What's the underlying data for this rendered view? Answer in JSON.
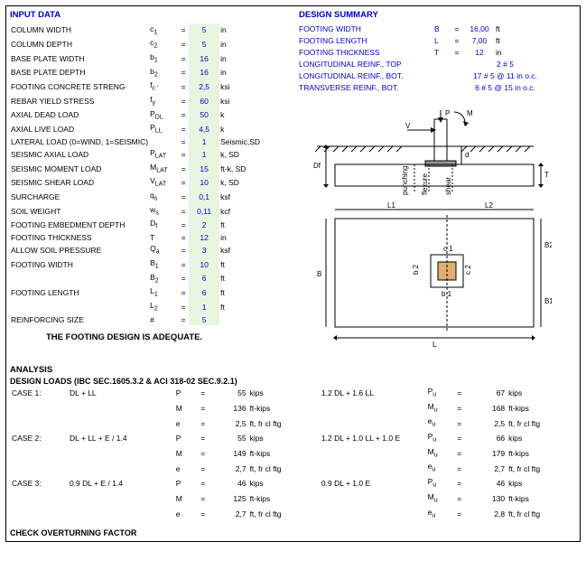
{
  "sections": {
    "input_title": "INPUT DATA",
    "summary_title": "DESIGN SUMMARY",
    "analysis_title": "ANALYSIS",
    "loads_title": "DESIGN  LOADS (IBC SEC.1605.3.2 & ACI 318-02 SEC.9.2.1)",
    "overturn_title": "CHECK OVERTURNING FACTOR"
  },
  "adequate": "THE FOOTING DESIGN IS ADEQUATE.",
  "input_rows": [
    {
      "label": "COLUMN WIDTH",
      "sym": "c",
      "sub": "1",
      "val": "5",
      "unit": "in"
    },
    {
      "label": "COLUMN DEPTH",
      "sym": "c",
      "sub": "2",
      "val": "5",
      "unit": "in"
    },
    {
      "label": "BASE PLATE WIDTH",
      "sym": "b",
      "sub": "1",
      "val": "16",
      "unit": "in"
    },
    {
      "label": "BASE PLATE DEPTH",
      "sym": "b",
      "sub": "2",
      "val": "16",
      "unit": "in"
    },
    {
      "label": "FOOTING CONCRETE STRENG·",
      "sym": "f",
      "sub": "c '",
      "val": "2,5",
      "unit": "ksi"
    },
    {
      "label": "REBAR YIELD STRESS",
      "sym": "f",
      "sub": "y",
      "val": "60",
      "unit": "ksi"
    },
    {
      "label": "AXIAL DEAD LOAD",
      "sym": "P",
      "sub": "DL",
      "val": "50",
      "unit": "k"
    },
    {
      "label": "AXIAL LIVE LOAD",
      "sym": "P",
      "sub": "LL",
      "val": "4,5",
      "unit": "k"
    },
    {
      "label": "LATERAL LOAD (0=WIND, 1=SEISMIC)",
      "sym": "",
      "sub": "",
      "val": "1",
      "unit": "Seismic,SD"
    },
    {
      "label": "SEISMIC AXIAL LOAD",
      "sym": "P",
      "sub": "LAT",
      "val": "1",
      "unit": "k, SD"
    },
    {
      "label": "SEISMIC MOMENT LOAD",
      "sym": "M",
      "sub": "LAT",
      "val": "15",
      "unit": "ft-k, SD"
    },
    {
      "label": "SEISMIC SHEAR LOAD",
      "sym": "V",
      "sub": "LAT",
      "val": "10",
      "unit": "k, SD"
    },
    {
      "label": "SURCHARGE",
      "sym": "q",
      "sub": "s",
      "val": "0,1",
      "unit": "ksf"
    },
    {
      "label": "SOIL WEIGHT",
      "sym": "w",
      "sub": "s",
      "val": "0,11",
      "unit": "kcf"
    },
    {
      "label": "FOOTING EMBEDMENT DEPTH",
      "sym": "D",
      "sub": "f",
      "val": "2",
      "unit": "ft"
    },
    {
      "label": "FOOTING THICKNESS",
      "sym": "T",
      "sub": "",
      "val": "12",
      "unit": "in"
    },
    {
      "label": "ALLOW SOIL PRESSURE",
      "sym": "Q",
      "sub": "a",
      "val": "3",
      "unit": "ksf"
    },
    {
      "label": "FOOTING WIDTH",
      "sym": "B",
      "sub": "1",
      "val": "10",
      "unit": "ft"
    },
    {
      "label": "",
      "sym": "B",
      "sub": "2",
      "val": "6",
      "unit": "ft"
    },
    {
      "label": "FOOTING LENGTH",
      "sym": "L",
      "sub": "1",
      "val": "6",
      "unit": "ft"
    },
    {
      "label": "",
      "sym": "L",
      "sub": "2",
      "val": "1",
      "unit": "ft"
    },
    {
      "label": "REINFORCING SIZE",
      "sym": "#",
      "sub": "",
      "val": "5",
      "unit": ""
    }
  ],
  "summary_rows": [
    {
      "label": "FOOTING WIDTH",
      "sym": "B",
      "val": "16,00",
      "unit": "ft"
    },
    {
      "label": "FOOTING LENGTH",
      "sym": "L",
      "val": "7,00",
      "unit": "ft"
    },
    {
      "label": "FOOTING THICKNESS",
      "sym": "T",
      "val": "12",
      "unit": "in"
    }
  ],
  "reinf": [
    {
      "label": "LONGITUDINAL REINF., TOP",
      "val": "2 # 5"
    },
    {
      "label": "LONGITUDINAL REINF., BOT.",
      "val": "17 # 5 @ 11 in o.c."
    },
    {
      "label": "TRANSVERSE REINF., BOT.",
      "val": "6 # 5 @ 15 in o.c."
    }
  ],
  "diagram_labels": {
    "P": "P",
    "M": "M",
    "V": "V",
    "Df": "Df",
    "d": "d",
    "T": "T",
    "L1": "L1",
    "L2": "L2",
    "c1": "c 1",
    "c2": "c 2",
    "b1": "b 1",
    "b2": "b 2",
    "B": "B",
    "B1": "B1",
    "B2": "B2",
    "L": "L",
    "punching": "punching",
    "flexure": "flexure",
    "shear": "shear"
  },
  "cases": [
    {
      "name": "CASE 1:",
      "combo": "DL + LL",
      "left": [
        {
          "sym": "P",
          "val": "55",
          "unit": "kips"
        },
        {
          "sym": "M",
          "val": "136",
          "unit": "ft-kips"
        },
        {
          "sym": "e",
          "val": "2,5",
          "unit": "ft, fr cl ftg"
        }
      ],
      "combo2": "1.2 DL + 1.6 LL",
      "right": [
        {
          "sym": "P",
          "sub": "u",
          "val": "67",
          "unit": "kips"
        },
        {
          "sym": "M",
          "sub": "u",
          "val": "168",
          "unit": "ft-kips"
        },
        {
          "sym": "e",
          "sub": "u",
          "val": "2,5",
          "unit": "ft, fr cl ftg"
        }
      ]
    },
    {
      "name": "CASE 2:",
      "combo": "DL + LL + E / 1.4",
      "left": [
        {
          "sym": "P",
          "val": "55",
          "unit": "kips"
        },
        {
          "sym": "M",
          "val": "149",
          "unit": "ft-kips"
        },
        {
          "sym": "e",
          "val": "2,7",
          "unit": "ft, fr cl ftg"
        }
      ],
      "combo2": "1.2 DL + 1.0 LL + 1.0 E",
      "right": [
        {
          "sym": "P",
          "sub": "u",
          "val": "66",
          "unit": "kips"
        },
        {
          "sym": "M",
          "sub": "u",
          "val": "179",
          "unit": "ft-kips"
        },
        {
          "sym": "e",
          "sub": "u",
          "val": "2,7",
          "unit": "ft, fr cl ftg"
        }
      ]
    },
    {
      "name": "CASE 3:",
      "combo": "0.9 DL + E / 1.4",
      "left": [
        {
          "sym": "P",
          "val": "46",
          "unit": "kips"
        },
        {
          "sym": "M",
          "val": "125",
          "unit": "ft-kips"
        },
        {
          "sym": "e",
          "val": "2,7",
          "unit": "ft, fr cl ftg"
        }
      ],
      "combo2": "0.9 DL + 1.0 E",
      "right": [
        {
          "sym": "P",
          "sub": "u",
          "val": "46",
          "unit": "kips"
        },
        {
          "sym": "M",
          "sub": "u",
          "val": "130",
          "unit": "ft-kips"
        },
        {
          "sym": "e",
          "sub": "u",
          "val": "2,8",
          "unit": "ft, fr cl ftg"
        }
      ]
    }
  ]
}
